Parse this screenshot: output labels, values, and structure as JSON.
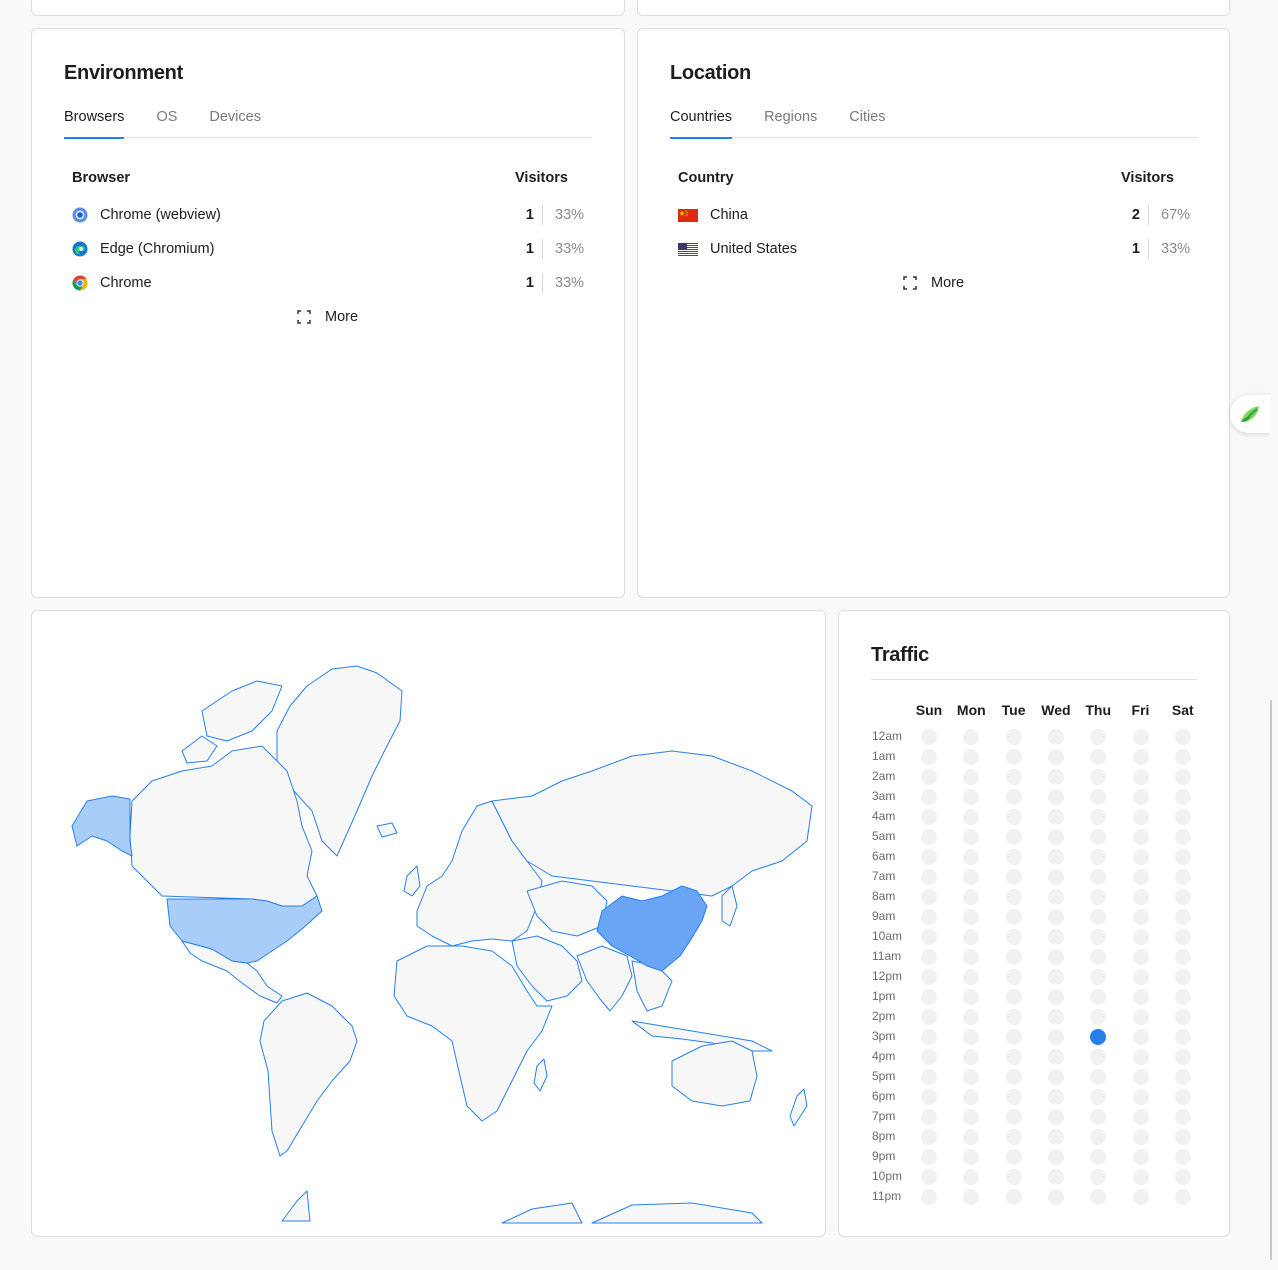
{
  "environment": {
    "title": "Environment",
    "tabs": [
      "Browsers",
      "OS",
      "Devices"
    ],
    "active_tab": "Browsers",
    "column_label": "Browser",
    "visitors_label": "Visitors",
    "rows": [
      {
        "name": "Chrome (webview)",
        "icon": "chrome-webview-icon",
        "visitors": "1",
        "percent": "33%"
      },
      {
        "name": "Edge (Chromium)",
        "icon": "edge-icon",
        "visitors": "1",
        "percent": "33%"
      },
      {
        "name": "Chrome",
        "icon": "chrome-icon",
        "visitors": "1",
        "percent": "33%"
      }
    ],
    "more_label": "More"
  },
  "location": {
    "title": "Location",
    "tabs": [
      "Countries",
      "Regions",
      "Cities"
    ],
    "active_tab": "Countries",
    "column_label": "Country",
    "visitors_label": "Visitors",
    "rows": [
      {
        "name": "China",
        "icon": "china-flag-icon",
        "visitors": "2",
        "percent": "67%"
      },
      {
        "name": "United States",
        "icon": "us-flag-icon",
        "visitors": "1",
        "percent": "33%"
      }
    ],
    "more_label": "More"
  },
  "map": {
    "highlighted_countries": [
      {
        "country": "China",
        "visitors": 2,
        "color": "#6aa5f5"
      },
      {
        "country": "United States",
        "visitors": 1,
        "color": "#a8cdf8"
      }
    ],
    "base_fill": "#f7f7f7",
    "stroke": "#2680eb"
  },
  "traffic": {
    "title": "Traffic",
    "days": [
      "Sun",
      "Mon",
      "Tue",
      "Wed",
      "Thu",
      "Fri",
      "Sat"
    ],
    "hours": [
      "12am",
      "1am",
      "2am",
      "3am",
      "4am",
      "5am",
      "6am",
      "7am",
      "8am",
      "9am",
      "10am",
      "11am",
      "12pm",
      "1pm",
      "2pm",
      "3pm",
      "4pm",
      "5pm",
      "6pm",
      "7pm",
      "8pm",
      "9pm",
      "10pm",
      "11pm"
    ],
    "active_cells": [
      {
        "day": "Thu",
        "hour": "3pm"
      }
    ],
    "accent": "#2680eb"
  }
}
